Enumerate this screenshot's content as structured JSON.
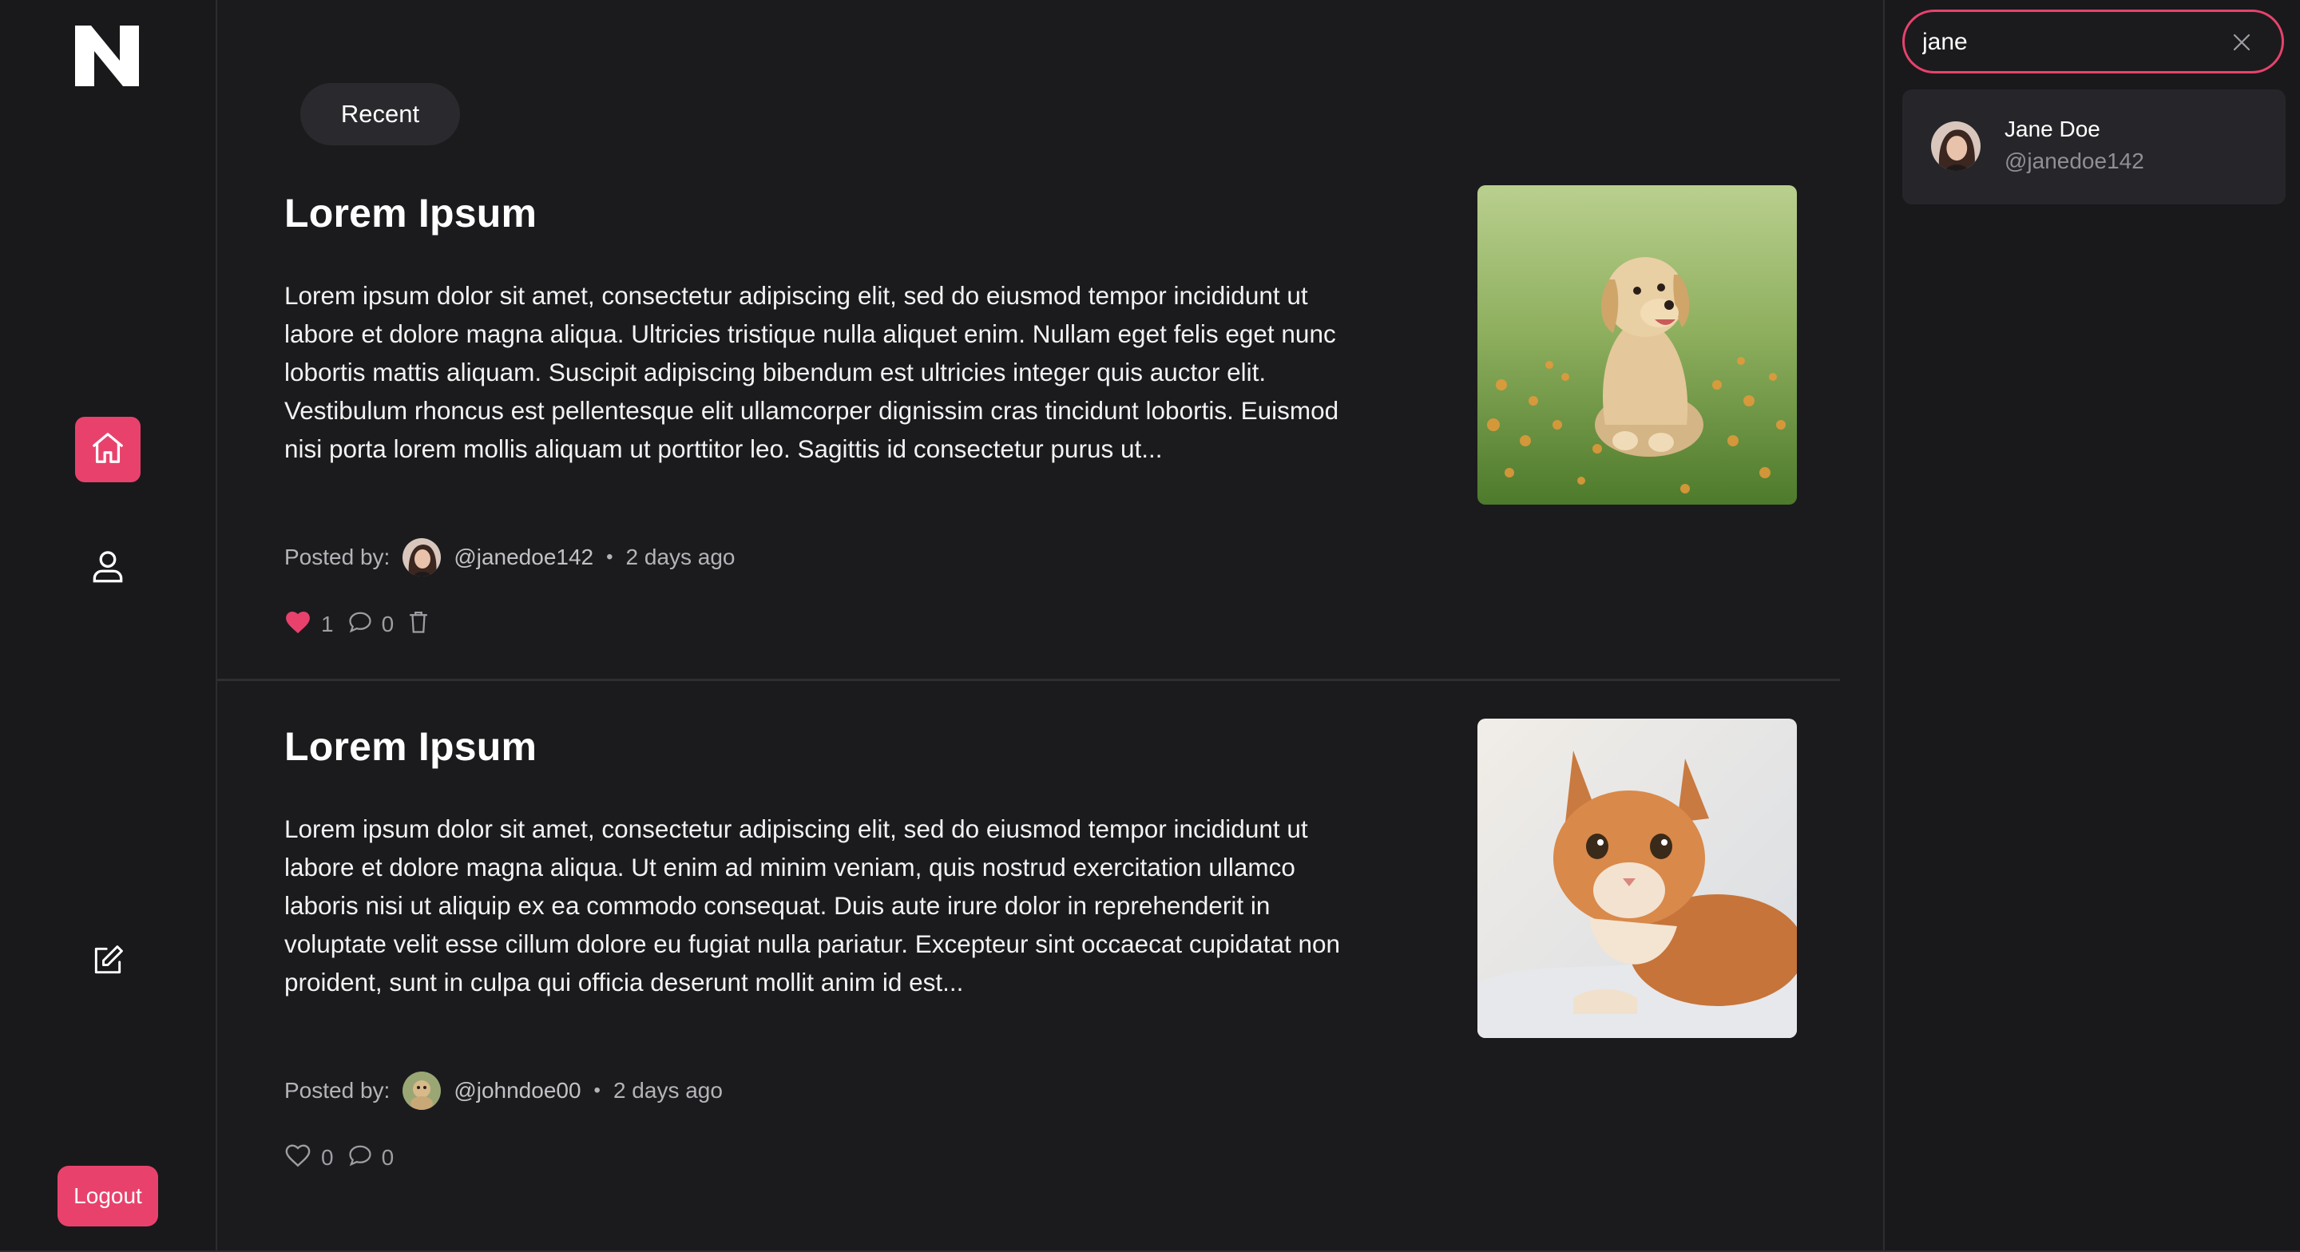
{
  "colors": {
    "accent": "#e8426c",
    "background": "#1b1b1e",
    "panel": "#19191c"
  },
  "sidebar": {
    "logo_icon": "n-logo-icon",
    "items": [
      {
        "name": "home",
        "icon": "home-icon",
        "active": true
      },
      {
        "name": "profile",
        "icon": "user-icon",
        "active": false
      },
      {
        "name": "compose",
        "icon": "edit-icon",
        "active": false
      }
    ],
    "logout_label": "Logout"
  },
  "feed": {
    "tab_label": "Recent",
    "posted_by_label": "Posted by:",
    "posts": [
      {
        "title": "Lorem Ipsum",
        "body": "Lorem ipsum dolor sit amet, consectetur adipiscing elit, sed do eiusmod tempor incididunt ut labore et dolore magna aliqua. Ultricies tristique nulla aliquet enim. Nullam eget felis eget nunc lobortis mattis aliquam. Suscipit adipiscing bibendum est ultricies integer quis auctor elit. Vestibulum rhoncus est pellentesque elit ullamcorper dignissim cras tincidunt lobortis. Euismod nisi porta lorem mollis aliquam ut porttitor leo. Sagittis id consectetur purus ut...",
        "image": "puppy-image",
        "author": "@janedoe142",
        "time": "2 days ago",
        "likes": "1",
        "comments": "0",
        "liked": true,
        "deletable": true
      },
      {
        "title": "Lorem Ipsum",
        "body": "Lorem ipsum dolor sit amet, consectetur adipiscing elit, sed do eiusmod tempor incididunt ut labore et dolore magna aliqua. Ut enim ad minim veniam, quis nostrud exercitation ullamco laboris nisi ut aliquip ex ea commodo consequat. Duis aute irure dolor in reprehenderit in voluptate velit esse cillum dolore eu fugiat nulla pariatur. Excepteur sint occaecat cupidatat non proident, sunt in culpa qui officia deserunt mollit anim id est...",
        "image": "kitten-image",
        "author": "@johndoe00",
        "time": "2 days ago",
        "likes": "0",
        "comments": "0",
        "liked": false,
        "deletable": false
      }
    ]
  },
  "search": {
    "value": "jane",
    "results": [
      {
        "name": "Jane Doe",
        "handle": "@janedoe142"
      }
    ]
  }
}
